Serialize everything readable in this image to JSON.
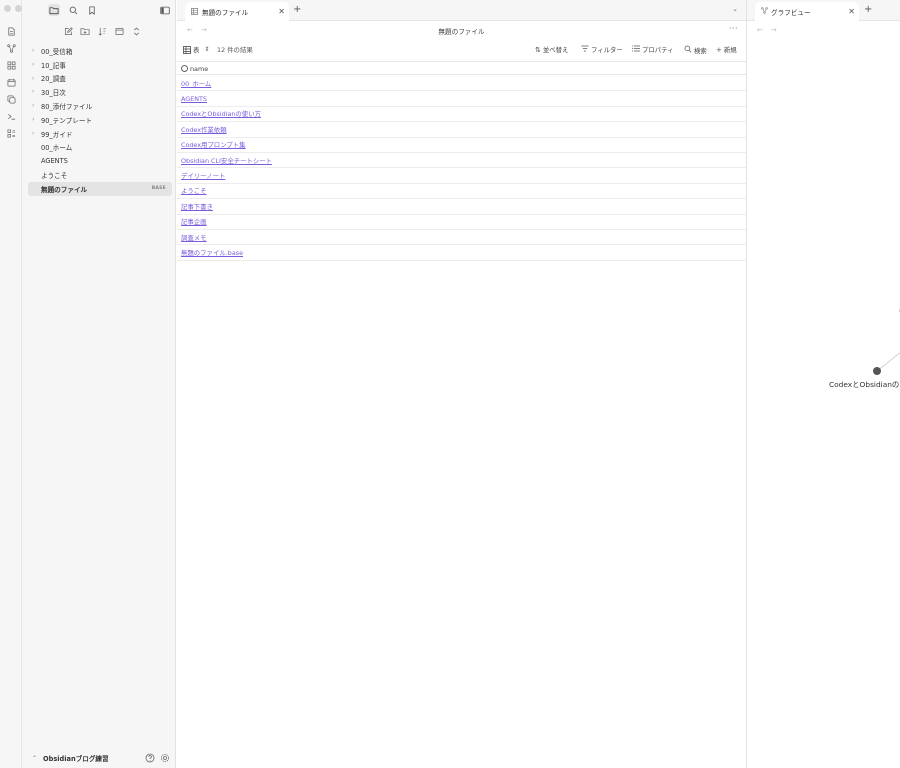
{
  "window": {
    "title": "無題のファイル"
  },
  "ribbon": {
    "icons": [
      "file-icon",
      "graph-icon",
      "canvas-icon",
      "calendar-icon",
      "copy-icon",
      "terminal-icon",
      "blocks-icon"
    ]
  },
  "sidebar": {
    "top_icons": [
      "folder-icon",
      "search-icon",
      "bookmark-icon"
    ],
    "actions": [
      "new-note-icon",
      "new-folder-icon",
      "sort-icon",
      "collapse-icon",
      "expand-icon"
    ],
    "items": [
      {
        "label": "00_受信箱",
        "type": "folder"
      },
      {
        "label": "10_記事",
        "type": "folder"
      },
      {
        "label": "20_調査",
        "type": "folder"
      },
      {
        "label": "30_日次",
        "type": "folder"
      },
      {
        "label": "80_添付ファイル",
        "type": "folder"
      },
      {
        "label": "90_テンプレート",
        "type": "folder"
      },
      {
        "label": "99_ガイド",
        "type": "folder"
      },
      {
        "label": "00_ホーム",
        "type": "file"
      },
      {
        "label": "AGENTS",
        "type": "file"
      },
      {
        "label": "ようこそ",
        "type": "file"
      },
      {
        "label": "無題のファイル",
        "type": "file",
        "badge": "BASE",
        "active": true
      }
    ],
    "vault_name": "Obsidianブログ練習"
  },
  "main": {
    "tab_label": "無題のファイル",
    "page_title": "無題のファイル",
    "toolbar": {
      "view_label": "表",
      "result_count": "12 件の結果",
      "sort_label": "並べ替え",
      "filter_label": "フィルター",
      "properties_label": "プロパティ",
      "search_label": "検索",
      "new_label": "新規"
    },
    "column_header": "name",
    "rows": [
      "00_ホーム",
      "AGENTS",
      "CodexとObsidianの使い方",
      "Codex作業依頼",
      "Codex用プロンプト集",
      "Obsidian CLI安全チートシート",
      "デイリーノート",
      "ようこそ",
      "記事下書き",
      "記事企画",
      "調査メモ",
      "無題のファイル.base"
    ]
  },
  "right_pane": {
    "tab_label": "グラフビュー",
    "graph_node_label": "CodexとObsidianの"
  },
  "colors": {
    "link": "#7b5cdd",
    "sidebar_bg": "#f6f6f6",
    "active_item_bg": "#e4e4e4",
    "node": "#555555"
  }
}
